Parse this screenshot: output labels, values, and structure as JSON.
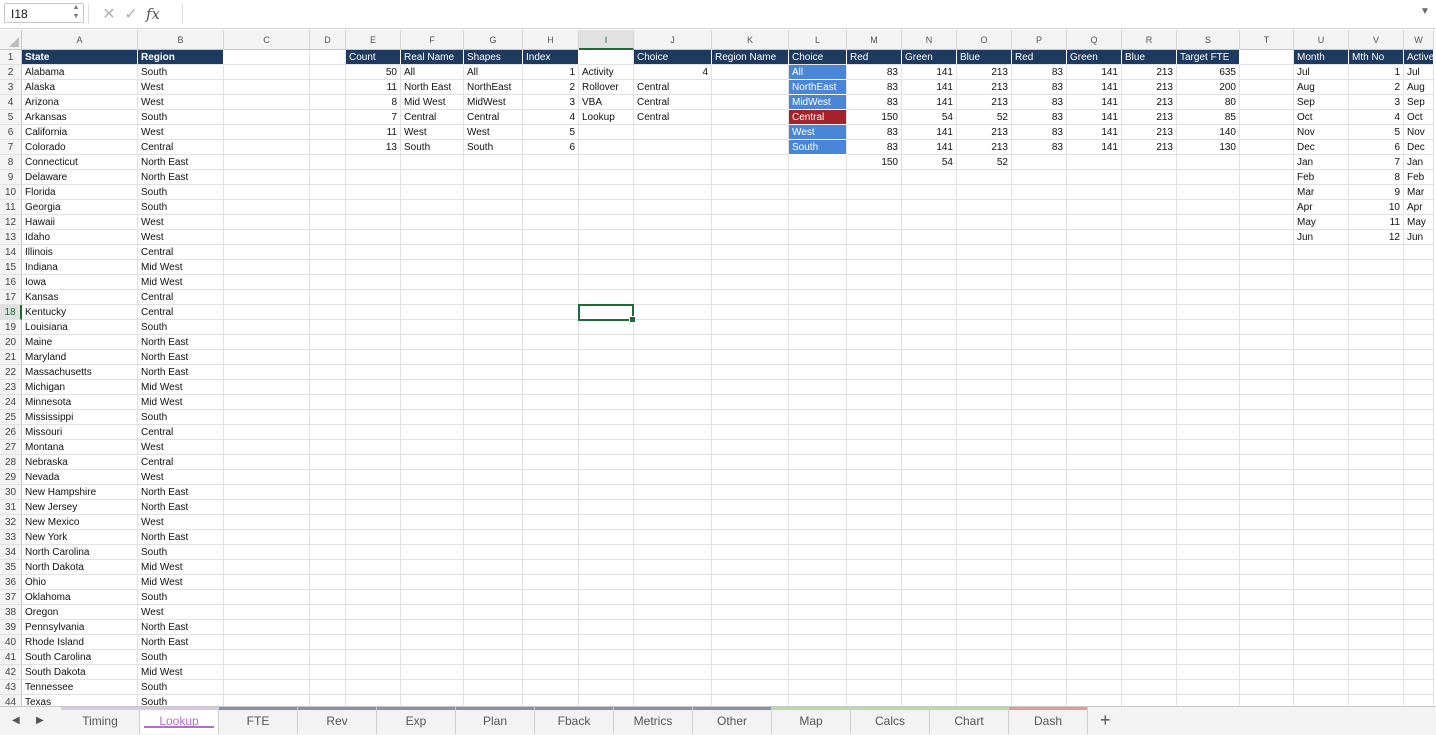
{
  "formula_bar": {
    "name_box": "I18",
    "formula": "",
    "cancel_icon": "✕",
    "enter_icon": "✓",
    "fx_label": "fx"
  },
  "columns": [
    {
      "letter": "A"
    },
    {
      "letter": "B"
    },
    {
      "letter": "C"
    },
    {
      "letter": "D"
    },
    {
      "letter": "E"
    },
    {
      "letter": "F"
    },
    {
      "letter": "G"
    },
    {
      "letter": "H"
    },
    {
      "letter": "I"
    },
    {
      "letter": "J"
    },
    {
      "letter": "K"
    },
    {
      "letter": "L"
    },
    {
      "letter": "M"
    },
    {
      "letter": "N"
    },
    {
      "letter": "O"
    },
    {
      "letter": "P"
    },
    {
      "letter": "Q"
    },
    {
      "letter": "R"
    },
    {
      "letter": "S"
    },
    {
      "letter": "T"
    },
    {
      "letter": "U"
    },
    {
      "letter": "V"
    },
    {
      "letter": "W"
    }
  ],
  "selected_cell": "I18",
  "colors": {
    "header_fill": "#1e3a5f",
    "choice_fill": "#4a86d8",
    "active_choice_fill": "#a6222b",
    "selection": "#1d6b37"
  },
  "table_states": {
    "headers": [
      "State",
      "Region"
    ],
    "rows": [
      [
        "Alabama",
        "South"
      ],
      [
        "Alaska",
        "West"
      ],
      [
        "Arizona",
        "West"
      ],
      [
        "Arkansas",
        "South"
      ],
      [
        "California",
        "West"
      ],
      [
        "Colorado",
        "Central"
      ],
      [
        "Connecticut",
        "North East"
      ],
      [
        "Delaware",
        "North East"
      ],
      [
        "Florida",
        "South"
      ],
      [
        "Georgia",
        "South"
      ],
      [
        "Hawaii",
        "West"
      ],
      [
        "Idaho",
        "West"
      ],
      [
        "Illinois",
        "Central"
      ],
      [
        "Indiana",
        "Mid West"
      ],
      [
        "Iowa",
        "Mid West"
      ],
      [
        "Kansas",
        "Central"
      ],
      [
        "Kentucky",
        "Central"
      ],
      [
        "Louisiana",
        "South"
      ],
      [
        "Maine",
        "North East"
      ],
      [
        "Maryland",
        "North East"
      ],
      [
        "Massachusetts",
        "North East"
      ],
      [
        "Michigan",
        "Mid West"
      ],
      [
        "Minnesota",
        "Mid West"
      ],
      [
        "Mississippi",
        "South"
      ],
      [
        "Missouri",
        "Central"
      ],
      [
        "Montana",
        "West"
      ],
      [
        "Nebraska",
        "Central"
      ],
      [
        "Nevada",
        "West"
      ],
      [
        "New Hampshire",
        "North East"
      ],
      [
        "New Jersey",
        "North East"
      ],
      [
        "New Mexico",
        "West"
      ],
      [
        "New York",
        "North East"
      ],
      [
        "North Carolina",
        "South"
      ],
      [
        "North Dakota",
        "Mid West"
      ],
      [
        "Ohio",
        "Mid West"
      ],
      [
        "Oklahoma",
        "South"
      ],
      [
        "Oregon",
        "West"
      ],
      [
        "Pennsylvania",
        "North East"
      ],
      [
        "Rhode Island",
        "North East"
      ],
      [
        "South Carolina",
        "South"
      ],
      [
        "South Dakota",
        "Mid West"
      ],
      [
        "Tennessee",
        "South"
      ],
      [
        "Texas",
        "South"
      ]
    ]
  },
  "table_regions": {
    "headers": [
      "Count",
      "Real Name",
      "Shapes",
      "Index"
    ],
    "rows": [
      [
        "50",
        "All",
        "All",
        "1"
      ],
      [
        "11",
        "North East",
        "NorthEast",
        "2"
      ],
      [
        "8",
        "Mid West",
        "MidWest",
        "3"
      ],
      [
        "7",
        "Central",
        "Central",
        "4"
      ],
      [
        "11",
        "West",
        "West",
        "5"
      ],
      [
        "13",
        "South",
        "South",
        "6"
      ]
    ]
  },
  "table_activity": {
    "header_choice": "Choice",
    "rows": [
      [
        "Activity",
        "4"
      ],
      [
        "Rollover",
        "Central"
      ],
      [
        "VBA",
        "Central"
      ],
      [
        "Lookup",
        "Central"
      ]
    ]
  },
  "region_name_header": "Region Name",
  "table_colors": {
    "headers": [
      "Choice",
      "Red",
      "Green",
      "Blue",
      "Red",
      "Green",
      "Blue",
      "Target FTE"
    ],
    "rows": [
      [
        "All",
        "83",
        "141",
        "213",
        "83",
        "141",
        "213",
        "635"
      ],
      [
        "NorthEast",
        "83",
        "141",
        "213",
        "83",
        "141",
        "213",
        "200"
      ],
      [
        "MidWest",
        "83",
        "141",
        "213",
        "83",
        "141",
        "213",
        "80"
      ],
      [
        "Central",
        "150",
        "54",
        "52",
        "83",
        "141",
        "213",
        "85"
      ],
      [
        "West",
        "83",
        "141",
        "213",
        "83",
        "141",
        "213",
        "140"
      ],
      [
        "South",
        "83",
        "141",
        "213",
        "83",
        "141",
        "213",
        "130"
      ]
    ],
    "extra_row": [
      "150",
      "54",
      "52"
    ],
    "active_choice": "Central"
  },
  "table_months": {
    "headers": [
      "Month",
      "Mth No",
      "Active"
    ],
    "rows": [
      [
        "Jul",
        "1",
        "Jul"
      ],
      [
        "Aug",
        "2",
        "Aug"
      ],
      [
        "Sep",
        "3",
        "Sep"
      ],
      [
        "Oct",
        "4",
        "Oct"
      ],
      [
        "Nov",
        "5",
        "Nov"
      ],
      [
        "Dec",
        "6",
        "Dec"
      ],
      [
        "Jan",
        "7",
        "Jan"
      ],
      [
        "Feb",
        "8",
        "Feb"
      ],
      [
        "Mar",
        "9",
        "Mar"
      ],
      [
        "Apr",
        "10",
        "Apr"
      ],
      [
        "May",
        "11",
        "May"
      ],
      [
        "Jun",
        "12",
        "Jun"
      ]
    ]
  },
  "sheet_tabs": [
    {
      "label": "Timing",
      "color": "#d9c7e6",
      "active": false
    },
    {
      "label": "Lookup",
      "color": "#d9c7e6",
      "active": true
    },
    {
      "label": "FTE",
      "color": "#8494a8",
      "active": false
    },
    {
      "label": "Rev",
      "color": "#8494a8",
      "active": false
    },
    {
      "label": "Exp",
      "color": "#8494a8",
      "active": false
    },
    {
      "label": "Plan",
      "color": "#8494a8",
      "active": false
    },
    {
      "label": "Fback",
      "color": "#8494a8",
      "active": false
    },
    {
      "label": "Metrics",
      "color": "#8494a8",
      "active": false
    },
    {
      "label": "Other",
      "color": "#8494a8",
      "active": false
    },
    {
      "label": "Map",
      "color": "#b8dca0",
      "active": false
    },
    {
      "label": "Calcs",
      "color": "#b8dca0",
      "active": false
    },
    {
      "label": "Chart",
      "color": "#b8dca0",
      "active": false
    },
    {
      "label": "Dash",
      "color": "#e49a9a",
      "active": false
    }
  ],
  "add_sheet_label": "+"
}
